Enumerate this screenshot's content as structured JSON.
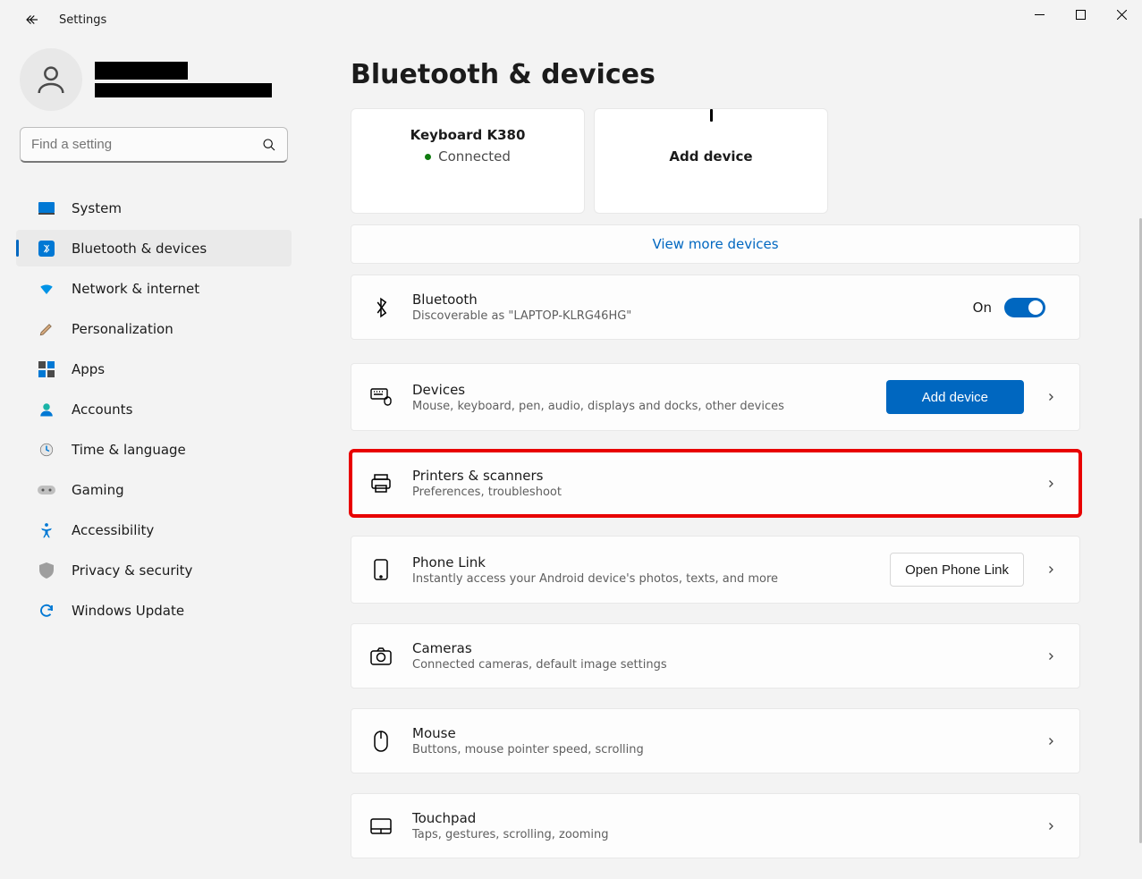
{
  "title": "Settings",
  "search": {
    "placeholder": "Find a setting"
  },
  "nav": [
    {
      "label": "System"
    },
    {
      "label": "Bluetooth & devices"
    },
    {
      "label": "Network & internet"
    },
    {
      "label": "Personalization"
    },
    {
      "label": "Apps"
    },
    {
      "label": "Accounts"
    },
    {
      "label": "Time & language"
    },
    {
      "label": "Gaming"
    },
    {
      "label": "Accessibility"
    },
    {
      "label": "Privacy & security"
    },
    {
      "label": "Windows Update"
    }
  ],
  "page": {
    "heading": "Bluetooth & devices",
    "device": {
      "name": "Keyboard K380",
      "status": "Connected"
    },
    "add_device_card": "Add device",
    "view_more": "View more devices",
    "bluetooth": {
      "title": "Bluetooth",
      "sub": "Discoverable as \"LAPTOP-KLRG46HG\"",
      "state": "On"
    },
    "rows": {
      "devices": {
        "title": "Devices",
        "sub": "Mouse, keyboard, pen, audio, displays and docks, other devices",
        "button": "Add device"
      },
      "printers": {
        "title": "Printers & scanners",
        "sub": "Preferences, troubleshoot"
      },
      "phone": {
        "title": "Phone Link",
        "sub": "Instantly access your Android device's photos, texts, and more",
        "button": "Open Phone Link"
      },
      "cameras": {
        "title": "Cameras",
        "sub": "Connected cameras, default image settings"
      },
      "mouse": {
        "title": "Mouse",
        "sub": "Buttons, mouse pointer speed, scrolling"
      },
      "touchpad": {
        "title": "Touchpad",
        "sub": "Taps, gestures, scrolling, zooming"
      }
    }
  }
}
